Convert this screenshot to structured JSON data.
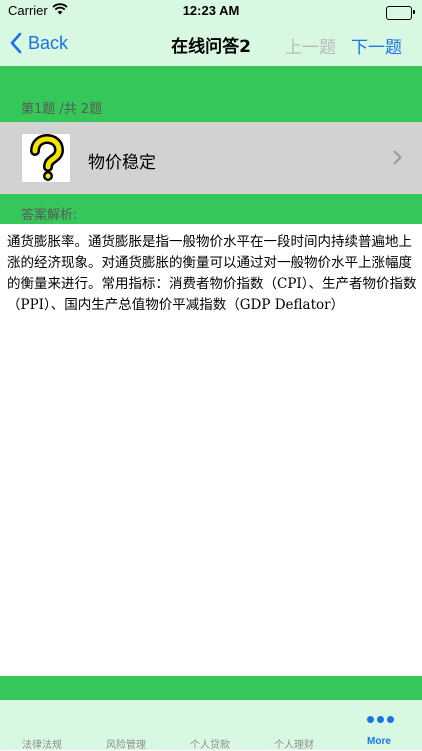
{
  "status_bar": {
    "carrier": "Carrier",
    "time": "12:23 AM"
  },
  "nav": {
    "back_label": "Back",
    "title": "在线问答2",
    "prev_label": "上一题",
    "next_label": "下一题"
  },
  "progress": {
    "text": "第1题 /共 2题"
  },
  "question": {
    "text": "物价稳定",
    "icon": "question-mark-icon"
  },
  "answer": {
    "label": "答案解析:",
    "body": "通货膨胀率。通货膨胀是指一般物价水平在一段时间内持续普遍地上涨的经济现象。对通货膨胀的衡量可以通过对一般物价水平上涨幅度的衡量来进行。常用指标：消费者物价指数（CPI）、生产者物价指数（PPI）、国内生产总值物价平减指数（GDP Deflator）"
  },
  "tabs": [
    {
      "label": "法律法规"
    },
    {
      "label": "风险管理"
    },
    {
      "label": "个人贷款"
    },
    {
      "label": "个人理财"
    },
    {
      "label": "More",
      "active": true,
      "icon": "more-dots-icon"
    }
  ],
  "colors": {
    "accent": "#1a73e8",
    "green": "#35c759",
    "light_green": "#d9f8e1",
    "row_gray": "#d2d2d2",
    "disabled": "#b9b9b9"
  }
}
